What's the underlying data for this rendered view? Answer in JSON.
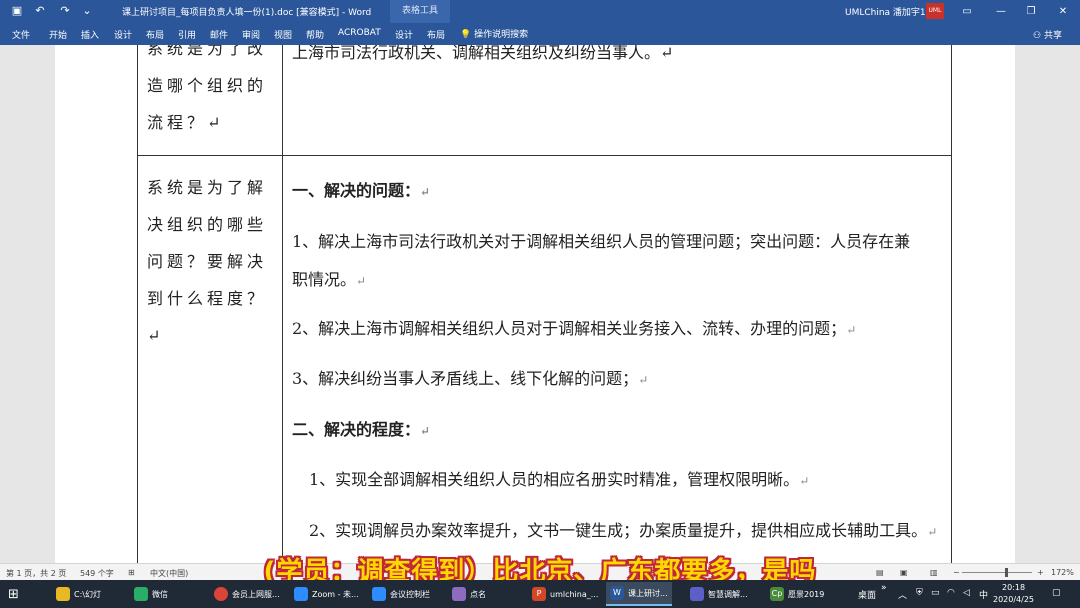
{
  "titlebar": {
    "doc_title": "课上研讨项目_每项目负责人填一份(1).doc  [兼容模式]  -  Word",
    "context_tab": "表格工具",
    "user": "UMLChina 潘加宇1",
    "avatar": "UML"
  },
  "ribbon": {
    "tabs": [
      "文件",
      "开始",
      "插入",
      "设计",
      "布局",
      "引用",
      "邮件",
      "审阅",
      "视图",
      "帮助",
      "ACROBAT",
      "设计",
      "布局"
    ],
    "tell_me": "操作说明搜索",
    "share": "共享"
  },
  "table": {
    "row1": {
      "question": "系统是为了改造哪个组织的流程？↵",
      "answer": "上海市司法行政机关、调解相关组织及纠纷当事人。↵"
    },
    "row2": {
      "question": "系统是为了解决组织的哪些问题？要解决到什么程度？↵",
      "heading1": "一、解决的问题：",
      "item1_line1": "1、解决上海市司法行政机关对于调解相关组织人员的管理问题；突出问题：人员存在兼",
      "item1_line2": "职情况。",
      "item2": "2、解决上海市调解相关组织人员对于调解相关业务接入、流转、办理的问题；",
      "item3": "3、解决纠纷当事人矛盾线上、线下化解的问题；",
      "heading2": "二、解决的程度：",
      "degree1": "1、实现全部调解相关组织人员的相应名册实时精准，管理权限明晰。",
      "degree2": "2、实现调解员办案效率提升，文书一键生成；办案质量提升，提供相应成长辅助工具。"
    },
    "para_mark": "↵"
  },
  "statusbar": {
    "page": "第 1 页，共 2 页",
    "words": "549 个字",
    "lang": "中文(中国)",
    "zoom": "172%"
  },
  "subtitle": "(学员：调查得到）比北京、广东都要多，是吗",
  "taskbar": {
    "items": [
      {
        "label": "C:\\幻灯",
        "color": "#e8b923"
      },
      {
        "label": "微信",
        "color": "#2aae67"
      },
      {
        "label": "会员上网服...",
        "color": "#db4437"
      },
      {
        "label": "Zoom - 未...",
        "color": "#2d8cff"
      },
      {
        "label": "会议控制栏",
        "color": "#2d8cff"
      },
      {
        "label": "点名",
        "color": "#8e6bbf"
      },
      {
        "label": "umlchina_...",
        "color": "#d24726"
      },
      {
        "label": "课上研讨...",
        "color": "#2b579a"
      },
      {
        "label": "智慧调解...",
        "color": "#5b5fc7"
      },
      {
        "label": "愿景2019",
        "color": "#4a8a3a"
      }
    ],
    "desktop": "桌面",
    "ime": "中",
    "time": "20:18",
    "date": "2020/4/25"
  }
}
